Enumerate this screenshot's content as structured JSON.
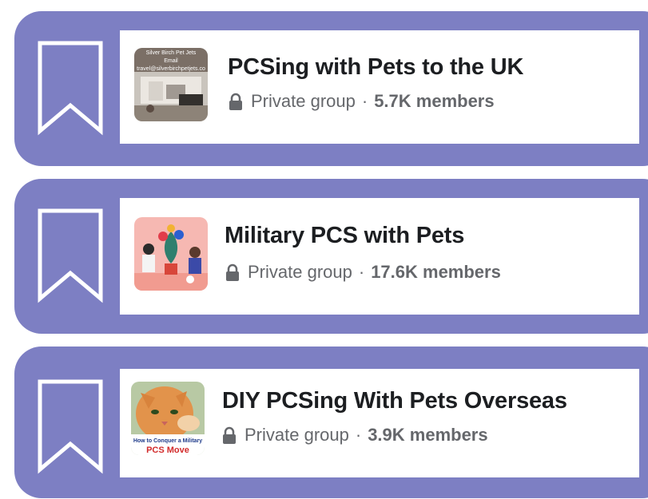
{
  "groups": [
    {
      "name": "PCSing with Pets to the UK",
      "privacy": "Private group",
      "separator": "·",
      "members": "5.7K members",
      "thumb_lines": [
        "Silver Birch Pet Jets",
        "Email",
        "travel@silverbirchpetjets.co"
      ]
    },
    {
      "name": "Military PCS with Pets",
      "privacy": "Private group",
      "separator": "·",
      "members": "17.6K members"
    },
    {
      "name": "DIY PCSing With Pets Overseas",
      "privacy": "Private group",
      "separator": "·",
      "members": "3.9K members",
      "thumb_lines": [
        "How to Conquer a Military",
        "PCS Move"
      ]
    }
  ],
  "icons": {
    "bookmark": "bookmark-icon",
    "lock": "lock-icon"
  },
  "colors": {
    "card_background": "#7d7fc3",
    "title_text": "#1c1e21",
    "meta_text": "#65676b"
  }
}
